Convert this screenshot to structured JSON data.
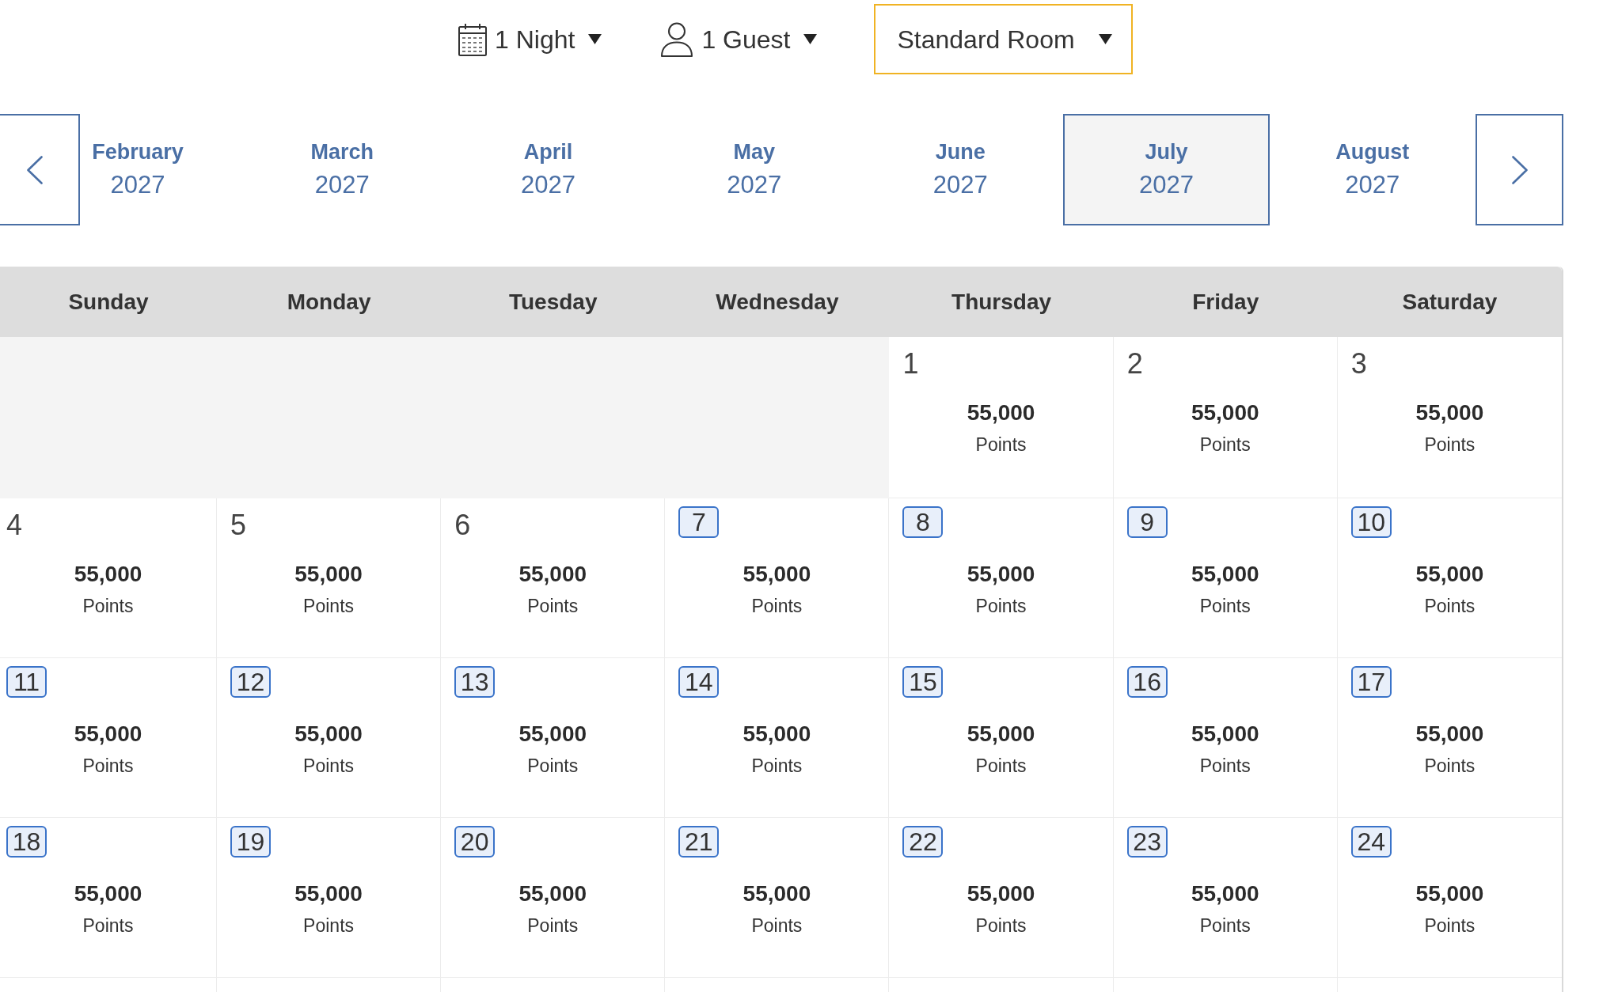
{
  "filters": [
    {
      "kind": "nights",
      "label": "1 Night",
      "focused": false
    },
    {
      "kind": "guests",
      "label": "1 Guest",
      "focused": false
    },
    {
      "kind": "room",
      "label": "Standard Room",
      "focused": true
    }
  ],
  "months": [
    {
      "month": "February",
      "year": "2027",
      "selected": false
    },
    {
      "month": "March",
      "year": "2027",
      "selected": false
    },
    {
      "month": "April",
      "year": "2027",
      "selected": false
    },
    {
      "month": "May",
      "year": "2027",
      "selected": false
    },
    {
      "month": "June",
      "year": "2027",
      "selected": false
    },
    {
      "month": "July",
      "year": "2027",
      "selected": true
    },
    {
      "month": "August",
      "year": "2027",
      "selected": false
    }
  ],
  "calendar": {
    "weekdays": [
      "Sunday",
      "Monday",
      "Tuesday",
      "Wednesday",
      "Thursday",
      "Friday",
      "Saturday"
    ],
    "weeks": [
      [
        {
          "kind": "blank"
        },
        {
          "kind": "blank"
        },
        {
          "kind": "blank"
        },
        {
          "kind": "blank"
        },
        {
          "kind": "day",
          "day": "1",
          "available": false,
          "points": "55,000",
          "unit": "Points"
        },
        {
          "kind": "day",
          "day": "2",
          "available": false,
          "points": "55,000",
          "unit": "Points"
        },
        {
          "kind": "day",
          "day": "3",
          "available": false,
          "points": "55,000",
          "unit": "Points"
        }
      ],
      [
        {
          "kind": "day",
          "day": "4",
          "available": false,
          "points": "55,000",
          "unit": "Points"
        },
        {
          "kind": "day",
          "day": "5",
          "available": false,
          "points": "55,000",
          "unit": "Points"
        },
        {
          "kind": "day",
          "day": "6",
          "available": false,
          "points": "55,000",
          "unit": "Points"
        },
        {
          "kind": "day",
          "day": "7",
          "available": true,
          "points": "55,000",
          "unit": "Points"
        },
        {
          "kind": "day",
          "day": "8",
          "available": true,
          "points": "55,000",
          "unit": "Points"
        },
        {
          "kind": "day",
          "day": "9",
          "available": true,
          "points": "55,000",
          "unit": "Points"
        },
        {
          "kind": "day",
          "day": "10",
          "available": true,
          "points": "55,000",
          "unit": "Points"
        }
      ],
      [
        {
          "kind": "day",
          "day": "11",
          "available": true,
          "points": "55,000",
          "unit": "Points"
        },
        {
          "kind": "day",
          "day": "12",
          "available": true,
          "points": "55,000",
          "unit": "Points"
        },
        {
          "kind": "day",
          "day": "13",
          "available": true,
          "points": "55,000",
          "unit": "Points"
        },
        {
          "kind": "day",
          "day": "14",
          "available": true,
          "points": "55,000",
          "unit": "Points"
        },
        {
          "kind": "day",
          "day": "15",
          "available": true,
          "points": "55,000",
          "unit": "Points"
        },
        {
          "kind": "day",
          "day": "16",
          "available": true,
          "points": "55,000",
          "unit": "Points"
        },
        {
          "kind": "day",
          "day": "17",
          "available": true,
          "points": "55,000",
          "unit": "Points"
        }
      ],
      [
        {
          "kind": "day",
          "day": "18",
          "available": true,
          "points": "55,000",
          "unit": "Points"
        },
        {
          "kind": "day",
          "day": "19",
          "available": true,
          "points": "55,000",
          "unit": "Points"
        },
        {
          "kind": "day",
          "day": "20",
          "available": true,
          "points": "55,000",
          "unit": "Points"
        },
        {
          "kind": "day",
          "day": "21",
          "available": true,
          "points": "55,000",
          "unit": "Points"
        },
        {
          "kind": "day",
          "day": "22",
          "available": true,
          "points": "55,000",
          "unit": "Points"
        },
        {
          "kind": "day",
          "day": "23",
          "available": true,
          "points": "55,000",
          "unit": "Points"
        },
        {
          "kind": "day",
          "day": "24",
          "available": true,
          "points": "55,000",
          "unit": "Points"
        }
      ]
    ]
  }
}
